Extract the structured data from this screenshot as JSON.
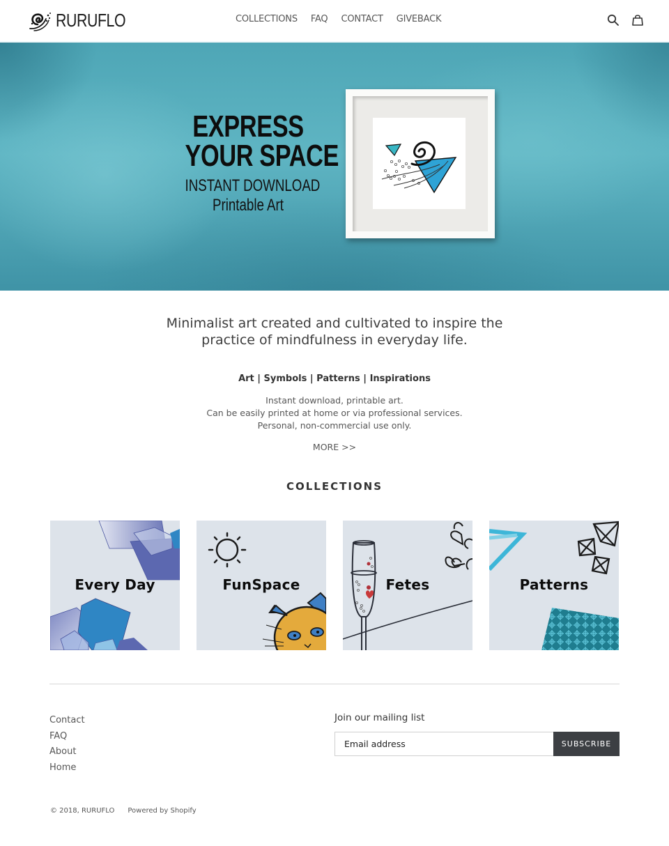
{
  "header": {
    "brand": "RURUFLO",
    "nav": [
      {
        "label": "COLLECTIONS"
      },
      {
        "label": "FAQ"
      },
      {
        "label": "CONTACT"
      },
      {
        "label": "GIVEBACK"
      }
    ],
    "icons": {
      "search": "search-icon",
      "cart": "shopping-bag-icon"
    }
  },
  "hero": {
    "line1": "EXPRESS",
    "line2": "YOUR SPACE",
    "line3": "INSTANT DOWNLOAD",
    "line4": "Printable Art",
    "colors": {
      "background": "#52a9b9",
      "triangle_teal": "#38b6c4",
      "triangle_blue": "#2ea3d6",
      "frame": "#fbfbf9"
    }
  },
  "intro": {
    "heading_line1": "Minimalist art created and cultivated to inspire the",
    "heading_line2": "practice of mindfulness in everyday life.",
    "tags": "Art | Symbols | Patterns | Inspirations",
    "desc": [
      "Instant download, printable art.",
      "Can be easily printed at home or via professional services.",
      "Personal, non-commercial use only."
    ],
    "more_link": "MORE >>"
  },
  "collections": {
    "title": "COLLECTIONS",
    "items": [
      {
        "label": "Every Day"
      },
      {
        "label": "FunSpace"
      },
      {
        "label": "Fetes"
      },
      {
        "label": "Patterns"
      }
    ]
  },
  "footer": {
    "links": [
      {
        "label": "Contact"
      },
      {
        "label": "FAQ"
      },
      {
        "label": "About"
      },
      {
        "label": "Home"
      }
    ],
    "newsletter": {
      "title": "Join our mailing list",
      "email_placeholder": "Email address",
      "email_value": "",
      "subscribe_label": "SUBSCRIBE"
    },
    "copyright": "© 2018, RURUFLO",
    "powered_by": "Powered by Shopify"
  },
  "theme": {
    "button_bg": "#3c3f43",
    "card_bg": "#dde3ea",
    "text": "#3a3a3a"
  }
}
